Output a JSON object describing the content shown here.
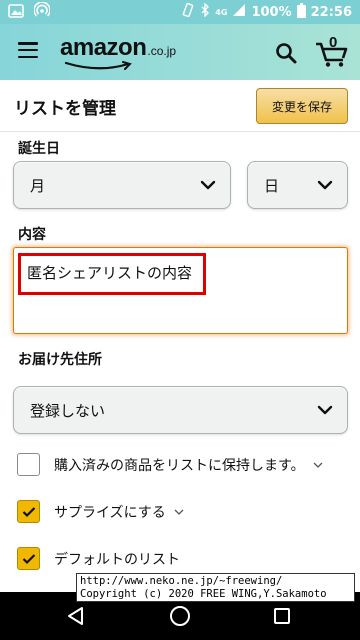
{
  "status_bar": {
    "network": "4G",
    "battery": "100%",
    "time": "22:56"
  },
  "header": {
    "logo_text": "amazon",
    "logo_suffix": ".co.jp",
    "cart_count": "0"
  },
  "page": {
    "title": "リストを管理",
    "save_label": "変更を保存"
  },
  "form": {
    "birthday_label": "誕生日",
    "month_value": "月",
    "day_value": "日",
    "contents_label": "内容",
    "contents_value": "匿名シェアリストの内容",
    "address_label": "お届け先住所",
    "address_value": "登録しない",
    "checkbox_purchased": "購入済みの商品をリストに保持します。",
    "checkbox_surprise": "サプライズにする",
    "checkbox_default": "デフォルトのリスト",
    "purchased_checked": false,
    "surprise_checked": true,
    "default_checked": true
  },
  "watermark": {
    "line1": "http://www.neko.ne.jp/~freewing/",
    "line2": "Copyright (c) 2020 FREE WING,Y.Sakamoto"
  },
  "colors": {
    "header_start": "#86d5d9",
    "header_end": "#a9e3d6",
    "save_button": "#f0c14b",
    "checkbox_checked": "#f0b800",
    "textarea_focus": "#e77600",
    "highlight": "#e00000"
  }
}
